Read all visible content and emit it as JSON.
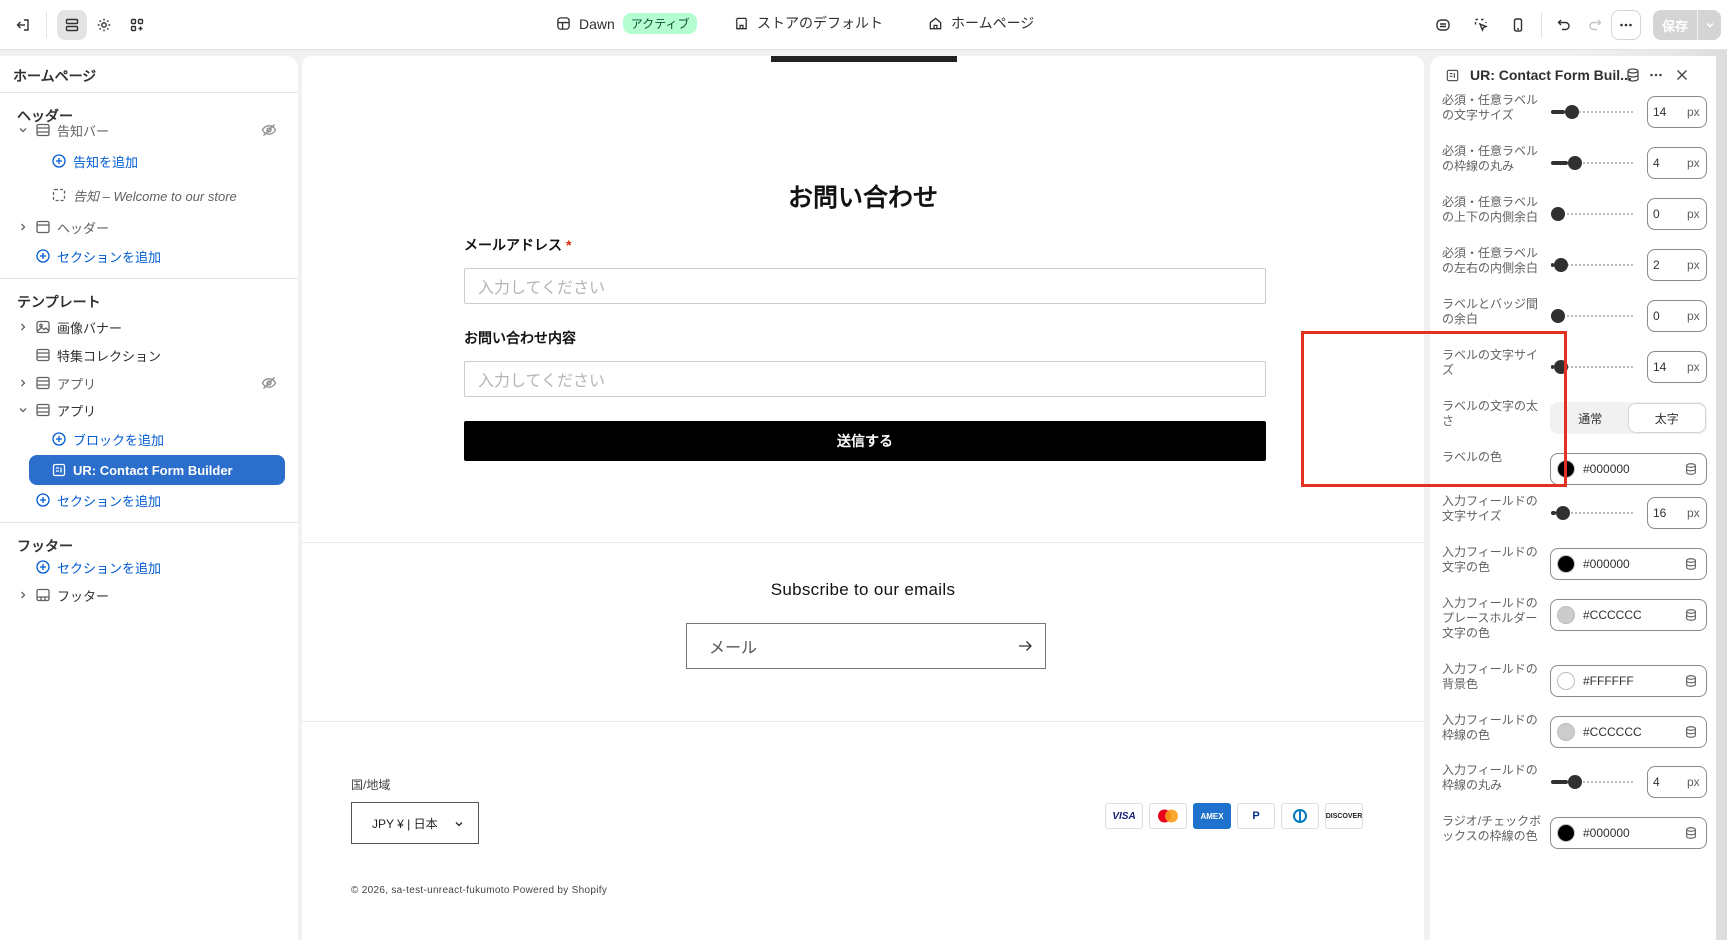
{
  "topbar": {
    "theme_name": "Dawn",
    "theme_status": "アクティブ",
    "store_default": "ストアのデフォルト",
    "page_select": "ホームページ",
    "save_label": "保存"
  },
  "sidebar": {
    "title": "ホームページ",
    "header_group": {
      "title": "ヘッダー",
      "items": [
        {
          "label": "告知バー"
        },
        {
          "label": "告知を追加"
        },
        {
          "label": "告知 – Welcome to our store"
        },
        {
          "label": "ヘッダー"
        },
        {
          "label": "セクションを追加"
        }
      ]
    },
    "template_group": {
      "title": "テンプレート",
      "items": [
        {
          "label": "画像バナー"
        },
        {
          "label": "特集コレクション"
        },
        {
          "label": "アプリ"
        },
        {
          "label": "アプリ"
        },
        {
          "label": "ブロックを追加"
        },
        {
          "label": "UR: Contact Form Builder"
        },
        {
          "label": "セクションを追加"
        }
      ]
    },
    "footer_group": {
      "title": "フッター",
      "items": [
        {
          "label": "セクションを追加"
        },
        {
          "label": "フッター"
        }
      ]
    }
  },
  "preview": {
    "form_title": "お問い合わせ",
    "email_label": "メールアドレス",
    "required_mark": "*",
    "email_placeholder": "入力してください",
    "message_label": "お問い合わせ内容",
    "message_placeholder": "入力してください",
    "submit_label": "送信する",
    "subscribe_title": "Subscribe to our emails",
    "subscribe_placeholder": "メール",
    "country_label": "国/地域",
    "country_value": "JPY ¥ | 日本",
    "payments": [
      "VISA",
      "Mastercard",
      "AMEX",
      "PayPal",
      "Diners",
      "DISCOVER"
    ],
    "copyright": "© 2026, sa-test-unreact-fukumoto Powered by Shopify"
  },
  "settings_panel": {
    "title": "UR: Contact Form Buil...",
    "rows": [
      {
        "label": "必須・任意ラベルの文字サイズ",
        "value": "14",
        "unit": "px",
        "level": 0.17
      },
      {
        "label": "必須・任意ラベルの枠線の丸み",
        "value": "4",
        "unit": "px",
        "level": 0.2
      },
      {
        "label": "必須・任意ラベルの上下の内側余白",
        "value": "0",
        "unit": "px",
        "level": 0.0
      },
      {
        "label": "必須・任意ラベルの左右の内側余白",
        "value": "2",
        "unit": "px",
        "level": 0.04
      },
      {
        "label": "ラベルとバッジ間の余白",
        "value": "0",
        "unit": "px",
        "level": 0.0
      },
      {
        "label": "ラベルの文字サイズ",
        "value": "14",
        "unit": "px",
        "level": 0.04
      },
      {
        "label": "ラベルの文字の太さ",
        "options": [
          "通常",
          "太字"
        ],
        "selected": "太字"
      },
      {
        "label": "ラベルの色",
        "color": "#000000"
      },
      {
        "label": "入力フィールドの文字サイズ",
        "value": "16",
        "unit": "px",
        "level": 0.06
      },
      {
        "label": "入力フィールドの文字の色",
        "color": "#000000"
      },
      {
        "label": "入力フィールドのプレースホルダー文字の色",
        "color": "#CCCCCC"
      },
      {
        "label": "入力フィールドの背景色",
        "color": "#FFFFFF"
      },
      {
        "label": "入力フィールドの枠線の色",
        "color": "#CCCCCC"
      },
      {
        "label": "入力フィールドの枠線の丸み",
        "value": "4",
        "unit": "px",
        "level": 0.2
      },
      {
        "label": "ラジオ/チェックボックスの枠線の色",
        "color": "#000000"
      }
    ]
  },
  "colors": {
    "accent": "#2c6ecb",
    "link": "#005bd3",
    "highlight": "#e0321f"
  }
}
